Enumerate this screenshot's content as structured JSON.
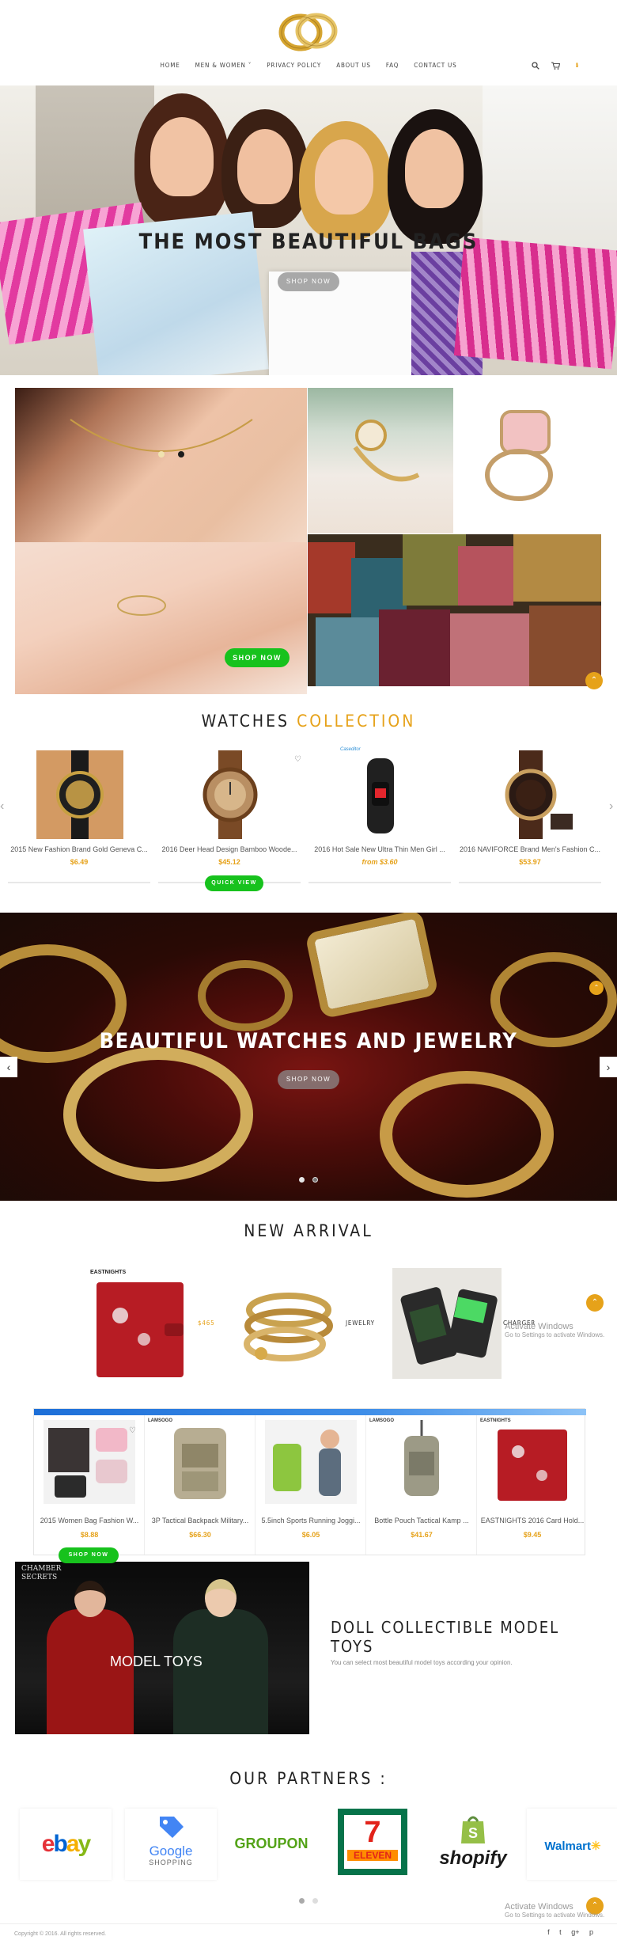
{
  "nav": {
    "items": [
      "HOME",
      "MEN & WOMEN ˅",
      "PRIVACY POLICY",
      "ABOUT US",
      "FAQ",
      "CONTACT US"
    ],
    "search_icon": "search-icon",
    "cart_icon": "cart-icon",
    "cart_count": "0"
  },
  "hero1": {
    "title": "THE MOST BEAUTIFUL BAGS",
    "button": "SHOP NOW"
  },
  "collage": {
    "button": "SHOP NOW"
  },
  "watches": {
    "title": "WATCHES",
    "title_accent": "COLLECTION",
    "quick_view": "QUICK VIEW",
    "brand_logo": "Caseditor",
    "items": [
      {
        "name": "2015 New Fashion Brand Gold Geneva C...",
        "price": "$6.49"
      },
      {
        "name": "2016 Deer Head Design Bamboo Woode...",
        "price": "$45.12"
      },
      {
        "name": "2016 Hot Sale New Ultra Thin Men Girl ...",
        "price": "from $3.60"
      },
      {
        "name": "2016 NAVIFORCE Brand Men's Fashion C...",
        "price": "$53.97"
      }
    ]
  },
  "hero2": {
    "title": "BEAUTIFUL WATCHES AND JEWELRY",
    "button": "SHOP NOW",
    "prev": "‹",
    "next": "›"
  },
  "arrival": {
    "title": "NEW ARRIVAL",
    "brand": "EASTNIGHTS",
    "price": "$465",
    "jewelry_label": "JEWELRY",
    "charger_label": "CHARGER"
  },
  "watermark": {
    "line1": "Activate Windows",
    "line2": "Go to Settings to activate Windows."
  },
  "products": [
    {
      "name": "2015 Women Bag Fashion W...",
      "price": "$8.88"
    },
    {
      "name": "3P Tactical Backpack Military...",
      "price": "$66.30"
    },
    {
      "name": "5.5inch Sports Running Joggi...",
      "price": "$6.05"
    },
    {
      "name": "Bottle Pouch Tactical Kamp ...",
      "price": "$41.67"
    },
    {
      "name": "EASTNIGHTS 2016 Card Hold...",
      "price": "$9.45"
    }
  ],
  "product_logos": {
    "lamsogo": "LAMSOGO",
    "eastnights": "EASTNIGHTS"
  },
  "doll": {
    "badge": "SHOP NOW",
    "image_label": "MODEL TOYS",
    "poster_text": "CHAMBER SECRETS",
    "title": "DOLL COLLECTIBLE MODEL TOYS",
    "desc": "You can select most beautiful model toys according your opinion."
  },
  "partners": {
    "title": "OUR PARTNERS :",
    "items": [
      {
        "name": "ebay"
      },
      {
        "name": "Google",
        "sub": "SHOPPING"
      },
      {
        "name": "GROUPON"
      },
      {
        "name": "7",
        "sub": "ELEVEN"
      },
      {
        "name": "shopify"
      },
      {
        "name": "Walmart"
      }
    ]
  },
  "footer": {
    "copyright": "Copyright © 2016. All rights reserved.",
    "social": [
      "f",
      "t",
      "g+",
      "p"
    ]
  },
  "colors": {
    "accent": "#e6a21a",
    "green": "#17c21d",
    "blue": "#1d6fd8"
  }
}
